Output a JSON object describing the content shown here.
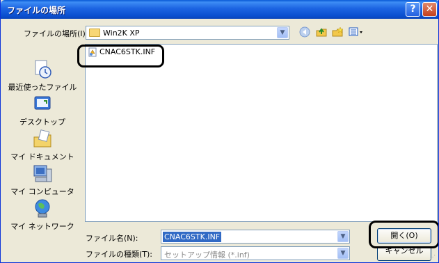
{
  "window": {
    "title": "ファイルの場所",
    "help_label": "?",
    "close_label": "✕"
  },
  "toolbar": {
    "look_in_label": "ファイルの場所(I):",
    "look_in_value": "Win2K XP",
    "back_icon": "back-arrow-icon",
    "up_icon": "up-folder-icon",
    "new_folder_icon": "new-folder-icon",
    "view_menu_icon": "view-menu-icon"
  },
  "places": [
    {
      "label": "最近使ったファイル",
      "icon": "recent-documents-icon"
    },
    {
      "label": "デスクトップ",
      "icon": "desktop-icon"
    },
    {
      "label": "マイ ドキュメント",
      "icon": "my-documents-icon"
    },
    {
      "label": "マイ コンピュータ",
      "icon": "my-computer-icon"
    },
    {
      "label": "マイ ネットワーク",
      "icon": "my-network-icon"
    }
  ],
  "files": [
    {
      "name": "CNAC6STK.INF",
      "icon": "setup-information-file-icon"
    }
  ],
  "bottom": {
    "file_name_label": "ファイル名(N):",
    "file_name_value": "CNAC6STK.INF",
    "file_type_label": "ファイルの種類(T):",
    "file_type_value": "セットアップ情報 (*.inf)",
    "open_label": "開く(O)",
    "cancel_label": "キャンセル"
  },
  "colors": {
    "titlebar": "#0a4fcf",
    "selection": "#316ac5",
    "callout": "#000000"
  }
}
